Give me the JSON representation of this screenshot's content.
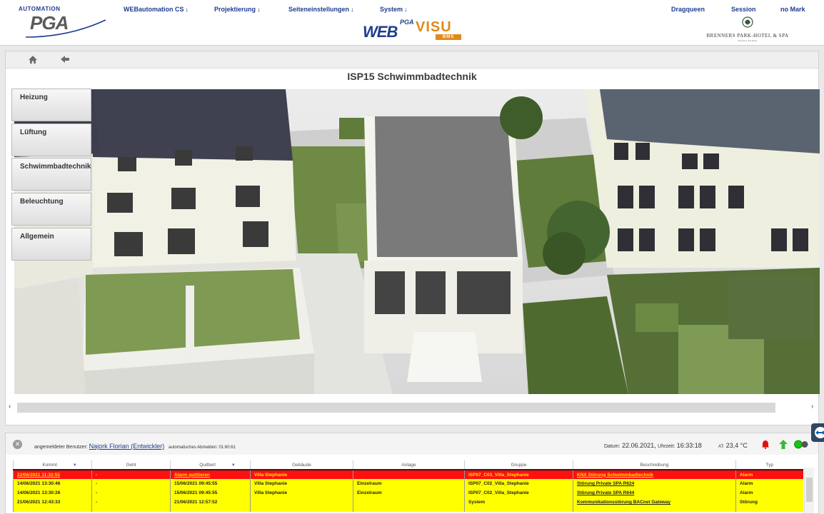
{
  "header": {
    "logo_top": "AUTOMATION",
    "logo_main": "PGA",
    "nav": [
      {
        "label": "WEBautomation CS"
      },
      {
        "label": "Projektierung"
      },
      {
        "label": "Seiteneinstellungen"
      },
      {
        "label": "System"
      }
    ],
    "nav_arrow": "↓",
    "center_logo": {
      "pga": "PGA",
      "web": "WEB",
      "visu": "VISU",
      "bms": "BMS"
    },
    "right_links": [
      {
        "label": "Dragqueen"
      },
      {
        "label": "Session"
      },
      {
        "label": "no Mark"
      }
    ],
    "brand_name": "BRENNERS PARK-HOTEL & SPA",
    "brand_sub": "BADEN-BADEN"
  },
  "toolbar": {
    "home_icon": "home-icon",
    "back_icon": "arrow-left-icon"
  },
  "page": {
    "title": "ISP15 Schwimmbadtechnik"
  },
  "side_menu": [
    {
      "label": "Heizung"
    },
    {
      "label": "Lüftung"
    },
    {
      "label": "Schwimmbadtechnik"
    },
    {
      "label": "Beleuchtung"
    },
    {
      "label": "Allgemein"
    }
  ],
  "scrollbar": {
    "left": "‹",
    "right": "›"
  },
  "status": {
    "user_label": "angemeldeter Benutzer:",
    "user_name": "Najork Florian (Entwickler)",
    "logout_text": "automatisches Abmelden: 01:60:61",
    "date_label": "Datum:",
    "date": "22.06.2021,",
    "time_label": "Uhrzeit:",
    "time": "16:33:18",
    "temp_label": "AT:",
    "temp": "23,4 °C",
    "icons": [
      "bell-icon",
      "arrow-up-icon",
      "green-status-dot-icon"
    ],
    "colors": {
      "alarm_red": "#ff1010",
      "warn_yellow": "#ffff00",
      "link_blue": "#1f3d8f",
      "accent_orange": "#e08a1c"
    }
  },
  "alarms": {
    "columns": [
      "Kommt",
      "Geht",
      "Quittiert",
      "Gebäude",
      "Anlage",
      "Gruppe",
      "Beschreibung",
      "Typ"
    ],
    "rows": [
      {
        "kommt": "22/06/2021 11:32:55",
        "geht": "-",
        "quittiert": "Alarm quittieren",
        "gebaeude": "Villa Stephanie",
        "anlage": "",
        "gruppe": "ISP07_C03_Villa_Stephanie",
        "beschreibung": "KNX Störung Schwimmbadtechnik",
        "typ": "Alarm"
      },
      {
        "kommt": "14/06/2021 13:30:46",
        "geht": "-",
        "quittiert": "15/06/2021 09:45:55",
        "gebaeude": "Villa Stephanie",
        "anlage": "Einzelraum",
        "gruppe": "ISP07_C02_Villa_Stephanie",
        "beschreibung": "Störung Private SPA R624",
        "typ": "Alarm"
      },
      {
        "kommt": "14/06/2021 13:30:26",
        "geht": "-",
        "quittiert": "15/06/2021 09:45:55",
        "gebaeude": "Villa Stephanie",
        "anlage": "Einzelraum",
        "gruppe": "ISP07_C02_Villa_Stephanie",
        "beschreibung": "Störung Private SPA R644",
        "typ": "Alarm"
      },
      {
        "kommt": "21/06/2021 12:43:33",
        "geht": "-",
        "quittiert": "21/06/2021 12:57:52",
        "gebaeude": "",
        "anlage": "",
        "gruppe": "System",
        "beschreibung": "Kommunikationsstörung BACnet Gateway",
        "typ": "Störung"
      }
    ]
  }
}
